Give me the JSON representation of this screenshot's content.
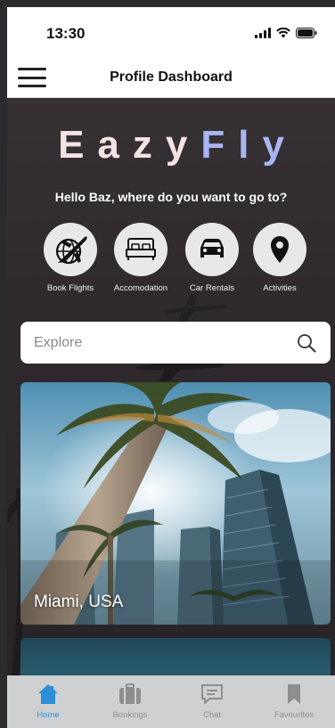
{
  "status_bar": {
    "time": "13:30",
    "icons": [
      "signal-icon",
      "wifi-icon",
      "battery-icon"
    ]
  },
  "header": {
    "title": "Profile Dashboard",
    "menu_icon": "hamburger-menu-icon"
  },
  "logo": {
    "part_1": "Eazy",
    "part_2": "Fly",
    "colors": {
      "part_1": "#f4e3e3",
      "part_2": "#a9b4f2"
    }
  },
  "greeting": "Hello Baz, where do you want to go to?",
  "categories": [
    {
      "label": "Book Flights",
      "icon": "globe-plane-icon"
    },
    {
      "label": "Accomodation",
      "icon": "bed-icon"
    },
    {
      "label": "Car Rentals",
      "icon": "car-icon"
    },
    {
      "label": "Activities",
      "icon": "map-pin-icon"
    }
  ],
  "search": {
    "placeholder": "Explore",
    "value": "",
    "icon": "search-icon"
  },
  "destinations": [
    {
      "title": "Miami, USA"
    }
  ],
  "tab_bar": {
    "tabs": [
      {
        "label": "Home",
        "icon": "home-icon",
        "active": true
      },
      {
        "label": "Bookings",
        "icon": "suitcase-icon",
        "active": false
      },
      {
        "label": "Chat",
        "icon": "chat-icon",
        "active": false
      },
      {
        "label": "Favourites",
        "icon": "bookmark-icon",
        "active": false
      }
    ],
    "colors": {
      "active": "#2a8fd6",
      "inactive": "#8e8e8e"
    }
  }
}
